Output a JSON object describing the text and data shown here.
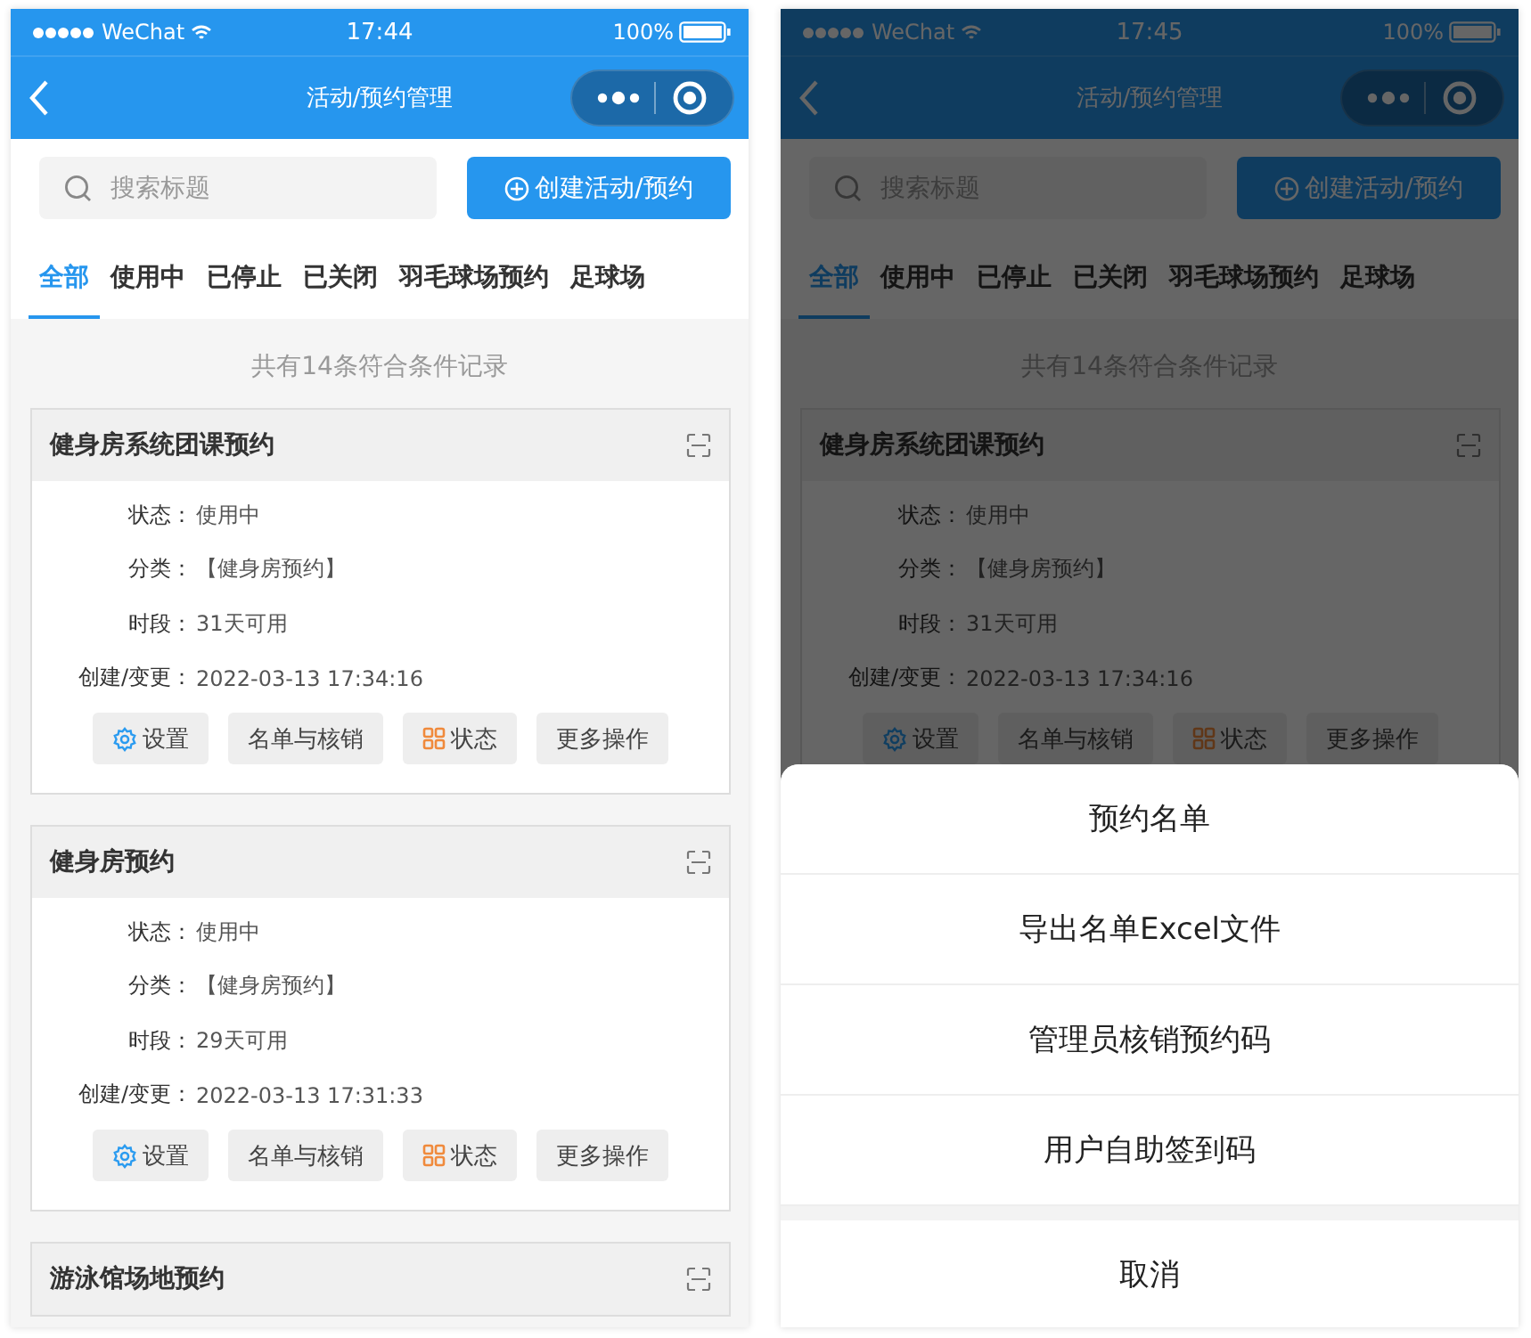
{
  "screens": [
    {
      "status_bar": {
        "carrier": "WeChat",
        "time": "17:44",
        "battery": "100%"
      },
      "nav_title": "活动/预约管理",
      "search": {
        "placeholder": "搜索标题"
      },
      "create_button": "创建活动/预约",
      "tabs": [
        {
          "label": "全部",
          "selected": true
        },
        {
          "label": "使用中",
          "selected": false
        },
        {
          "label": "已停止",
          "selected": false
        },
        {
          "label": "已关闭",
          "selected": false
        },
        {
          "label": "羽毛球场预约",
          "selected": false
        },
        {
          "label": "足球场",
          "selected": false
        }
      ],
      "count_text": "共有14条符合条件记录",
      "cards": [
        {
          "title": "健身房系统团课预约",
          "fields": [
            {
              "label": "状态：",
              "value": "使用中"
            },
            {
              "label": "分类：",
              "value": "【健身房预约】"
            },
            {
              "label": "时段：",
              "value": "31天可用"
            },
            {
              "label": "创建/变更：",
              "value": "2022-03-13 17:34:16"
            }
          ],
          "actions": [
            {
              "label": "设置",
              "kind": "settings"
            },
            {
              "label": "名单与核销",
              "kind": "plain"
            },
            {
              "label": "状态",
              "kind": "status"
            },
            {
              "label": "更多操作",
              "kind": "plain"
            }
          ]
        },
        {
          "title": "健身房预约",
          "fields": [
            {
              "label": "状态：",
              "value": "使用中"
            },
            {
              "label": "分类：",
              "value": "【健身房预约】"
            },
            {
              "label": "时段：",
              "value": "29天可用"
            },
            {
              "label": "创建/变更：",
              "value": "2022-03-13 17:31:33"
            }
          ],
          "actions": [
            {
              "label": "设置",
              "kind": "settings"
            },
            {
              "label": "名单与核销",
              "kind": "plain"
            },
            {
              "label": "状态",
              "kind": "status"
            },
            {
              "label": "更多操作",
              "kind": "plain"
            }
          ]
        },
        {
          "title": "游泳馆场地预约"
        }
      ],
      "dimmed": false
    },
    {
      "status_bar": {
        "carrier": "WeChat",
        "time": "17:45",
        "battery": "100%"
      },
      "nav_title": "活动/预约管理",
      "search": {
        "placeholder": "搜索标题"
      },
      "create_button": "创建活动/预约",
      "tabs": [
        {
          "label": "全部",
          "selected": true
        },
        {
          "label": "使用中",
          "selected": false
        },
        {
          "label": "已停止",
          "selected": false
        },
        {
          "label": "已关闭",
          "selected": false
        },
        {
          "label": "羽毛球场预约",
          "selected": false
        },
        {
          "label": "足球场",
          "selected": false
        }
      ],
      "count_text": "共有14条符合条件记录",
      "cards": [
        {
          "title": "健身房系统团课预约",
          "fields": [
            {
              "label": "状态：",
              "value": "使用中"
            },
            {
              "label": "分类：",
              "value": "【健身房预约】"
            },
            {
              "label": "时段：",
              "value": "31天可用"
            },
            {
              "label": "创建/变更：",
              "value": "2022-03-13 17:34:16"
            }
          ],
          "actions": [
            {
              "label": "设置",
              "kind": "settings"
            },
            {
              "label": "名单与核销",
              "kind": "plain"
            },
            {
              "label": "状态",
              "kind": "status"
            },
            {
              "label": "更多操作",
              "kind": "plain"
            }
          ]
        }
      ],
      "dimmed": true,
      "action_sheet": {
        "items": [
          "预约名单",
          "导出名单Excel文件",
          "管理员核销预约码",
          "用户自助签到码"
        ],
        "cancel": "取消"
      }
    }
  ]
}
